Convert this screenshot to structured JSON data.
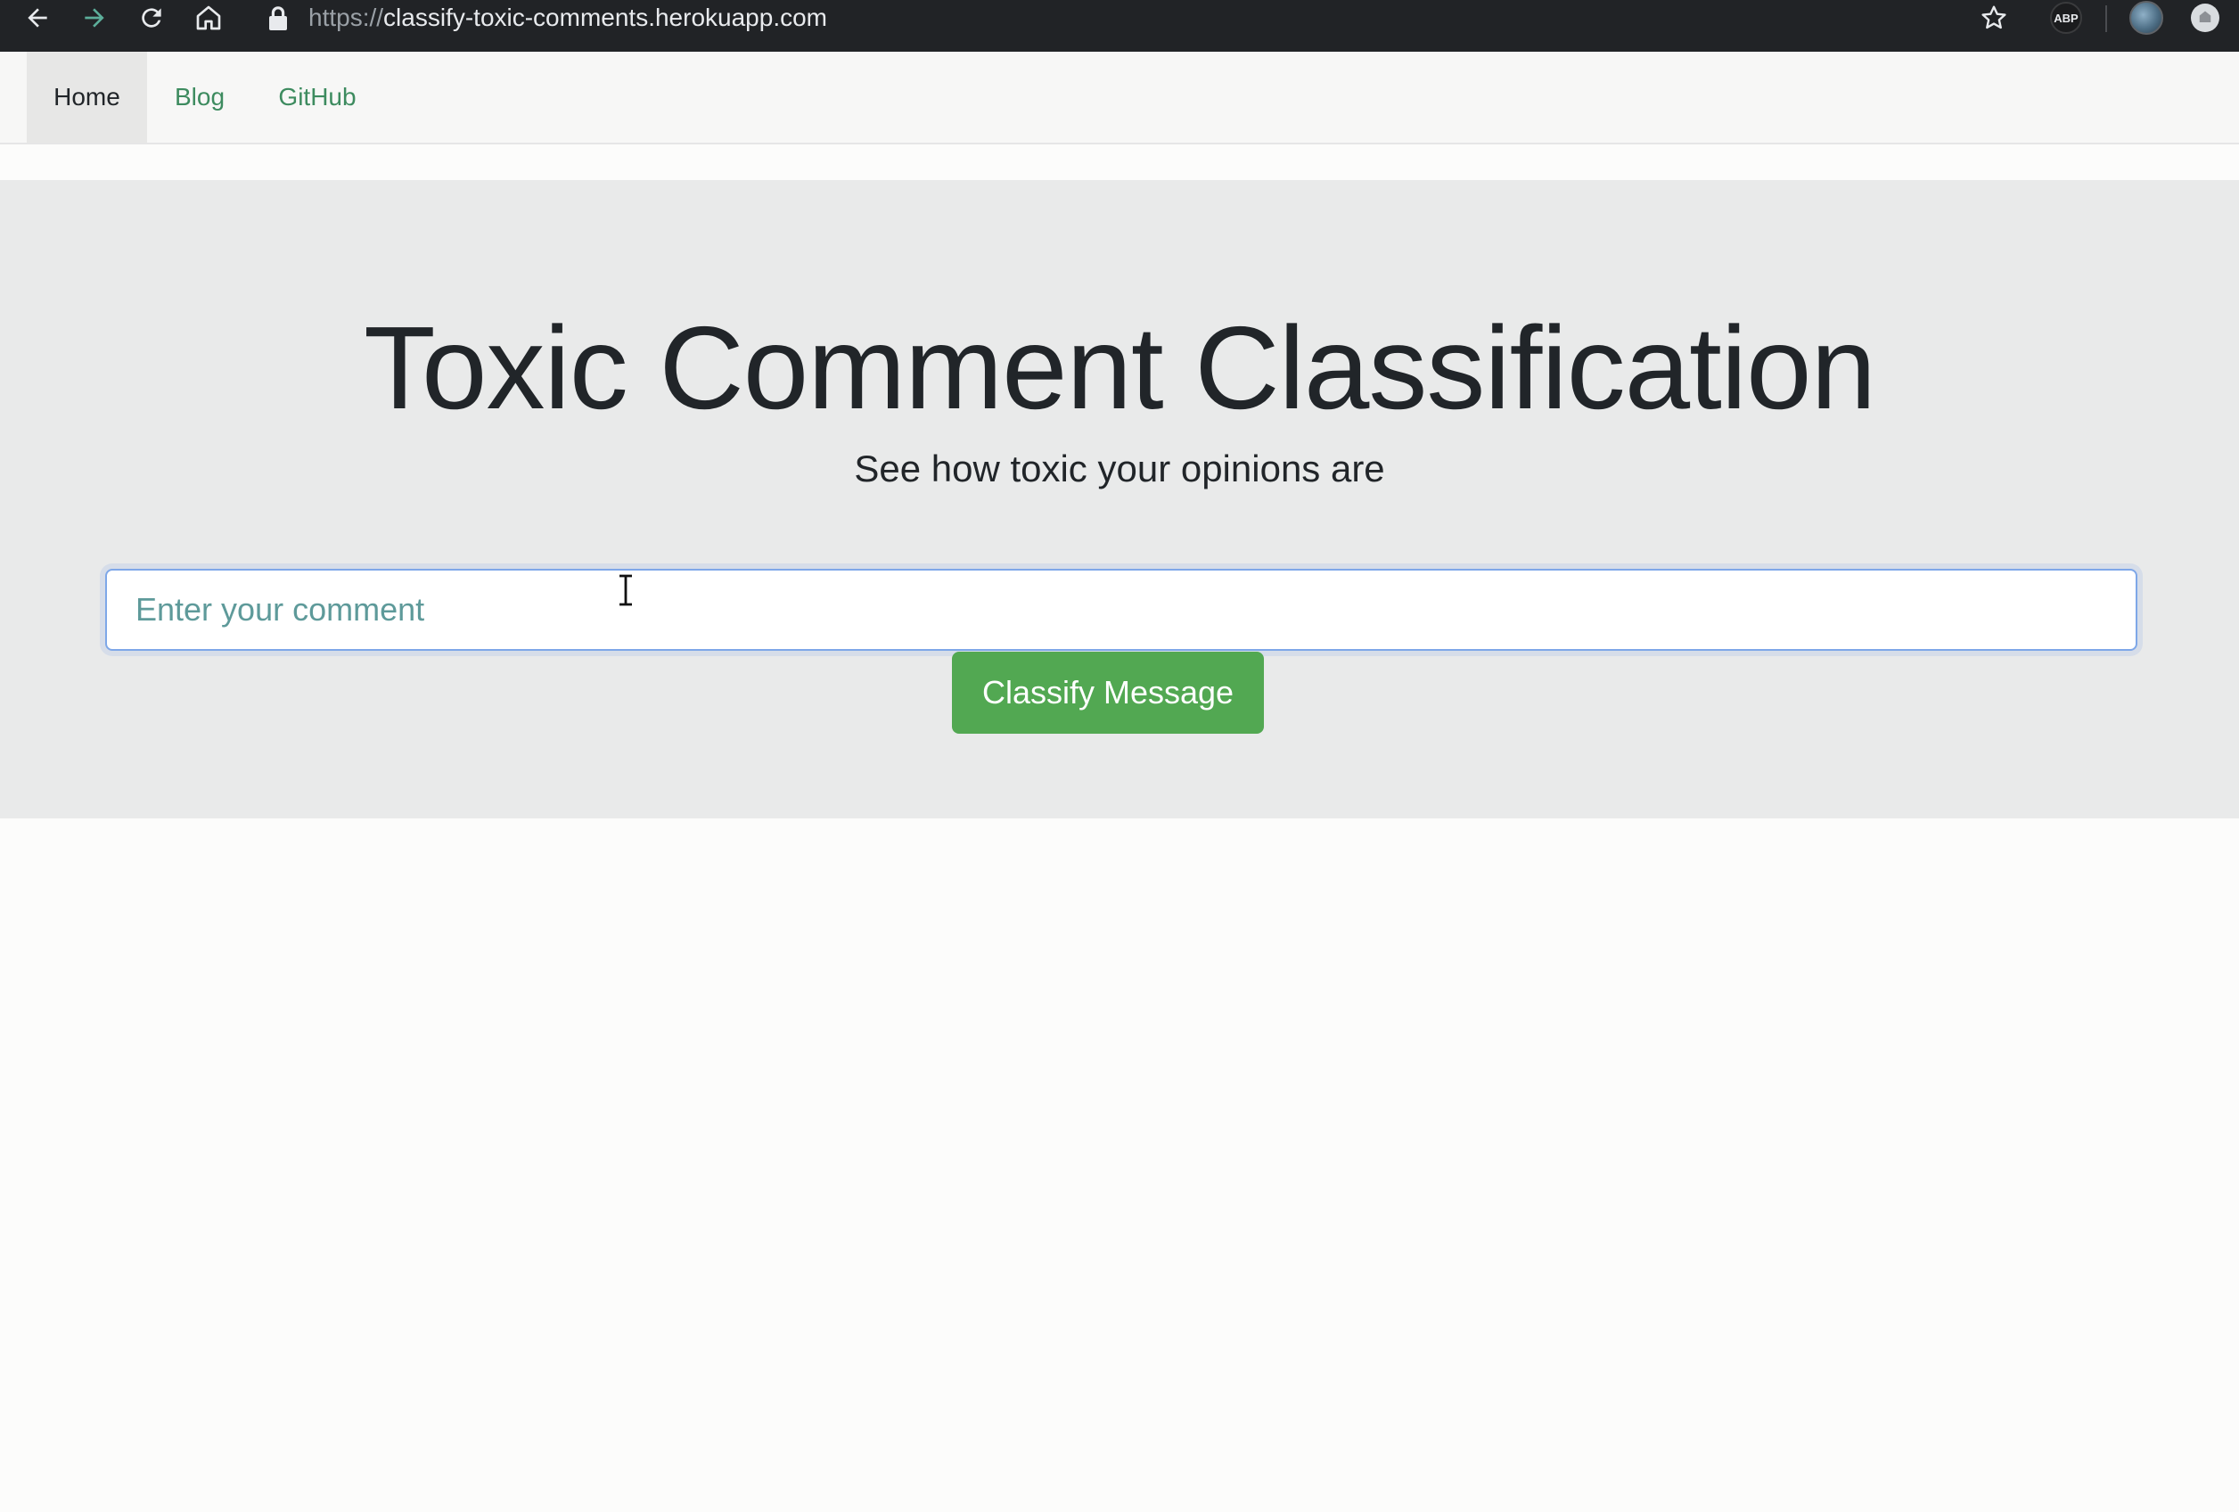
{
  "browser": {
    "url_scheme": "https://",
    "url_host": "classify-toxic-comments.herokuapp.com",
    "abp_label": "ABP"
  },
  "navbar": {
    "items": [
      {
        "label": "Home",
        "active": true
      },
      {
        "label": "Blog",
        "active": false
      },
      {
        "label": "GitHub",
        "active": false
      }
    ]
  },
  "jumbotron": {
    "title": "Toxic Comment Classification",
    "subtitle": "See how toxic your opinions are",
    "input_placeholder": "Enter your comment",
    "button_label": "Classify Message"
  },
  "colors": {
    "chrome_bg": "#212326",
    "link": "#3d8b5f",
    "button": "#52a852",
    "jumbotron_bg": "#e9eaea"
  },
  "icons": [
    "back-arrow-icon",
    "forward-arrow-icon",
    "reload-icon",
    "home-icon",
    "lock-icon",
    "star-icon",
    "abp-icon",
    "profile-avatar",
    "extension-icon",
    "text-cursor-icon"
  ]
}
